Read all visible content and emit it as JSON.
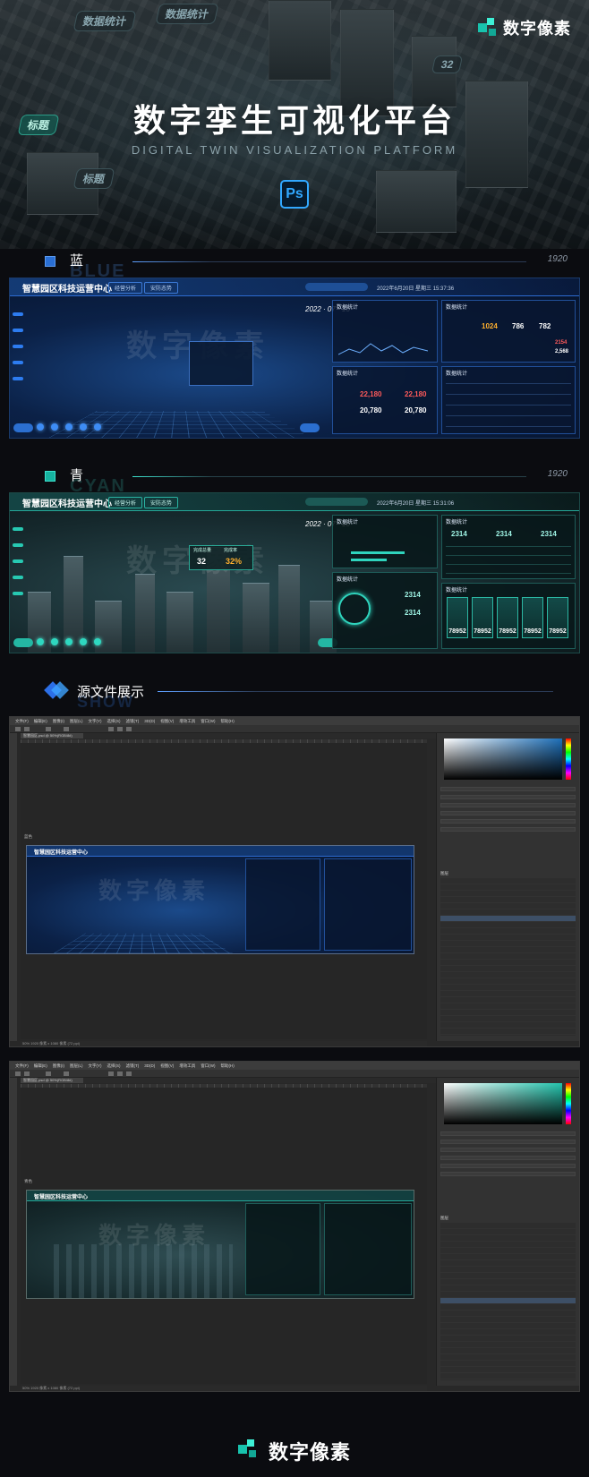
{
  "brand": {
    "name": "数字像素"
  },
  "hero": {
    "title": "数字孪生可视化平台",
    "subtitle": "DIGITAL TWIN VISUALIZATION PLATFORM",
    "ps_badge": "Ps",
    "tags": [
      "数据统计",
      "数据统计",
      "标题",
      "标题"
    ],
    "map_number": "32"
  },
  "sections": {
    "blue": {
      "label": "蓝",
      "ghost": "BLUE",
      "resolution": "1920"
    },
    "cyan": {
      "label": "青",
      "ghost": "CYAN",
      "resolution": "1920"
    },
    "source": {
      "label": "源文件展示",
      "ghost": "SHOW"
    }
  },
  "dashboard_blue": {
    "title": "智慧园区科技运营中心",
    "nav": [
      "经营分析",
      "安防态势"
    ],
    "date": "2022 · 07 · 16",
    "time": "2022年6月20日  星期三  15:37:36",
    "panel_title_1": "数据统计",
    "panel_title_2": "数据统计",
    "panel_title_3": "数据统计",
    "panel_title_4": "数据统计",
    "stats": [
      "1024",
      "786",
      "782"
    ],
    "stat_labels": [
      "上架量",
      "在架量",
      "待架量"
    ],
    "table_head": [
      "编号",
      "规则名称",
      "监控数量",
      "监控时间"
    ],
    "red_values": [
      "22,180",
      "22,180"
    ],
    "white_values": [
      "20,780",
      "20,780"
    ],
    "side_values": [
      "2154",
      "2,568",
      "1459"
    ],
    "watermark": "数字像素"
  },
  "dashboard_cyan": {
    "title": "智慧园区科技运营中心",
    "nav": [
      "经营分析",
      "安防态势"
    ],
    "date": "2022 · 07 · 16",
    "time": "2022年6月20日  星期三  15:31:06",
    "panel_title_1": "数据统计",
    "panel_title_2": "数据统计",
    "panel_title_3": "数据统计",
    "panel_title_4": "数据统计",
    "popup_labels": [
      "完成总量",
      "完成率"
    ],
    "popup_values": [
      "32",
      "32%"
    ],
    "stats": [
      "2314",
      "2314",
      "2314"
    ],
    "bottom_values": [
      "2314",
      "2314"
    ],
    "tiles": [
      "78952",
      "78952",
      "78952",
      "78952",
      "78952"
    ],
    "tile_label": "公示设施",
    "watermark": "数字像素"
  },
  "photoshop": {
    "menu": [
      "文件(F)",
      "编辑(E)",
      "图像(I)",
      "图层(L)",
      "文字(Y)",
      "选择(S)",
      "滤镜(T)",
      "3D(D)",
      "视图(V)",
      "增效工具",
      "窗口(W)",
      "帮助(H)"
    ],
    "tab_label": "智慧园区.psd @ 50%(RGB/8#)",
    "artboard_label_1": "蓝色",
    "artboard_label_2": "青色",
    "art_title": "智慧园区科技运营中心",
    "layers_title": "图层",
    "status": "50%  1920 像素 x 1080 像素 (72 ppi)"
  },
  "colors": {
    "blue_accent": "#2d7cf0",
    "cyan_accent": "#27c9b2",
    "brand": "#20e0c4",
    "ps_blue": "#31a8ff"
  }
}
